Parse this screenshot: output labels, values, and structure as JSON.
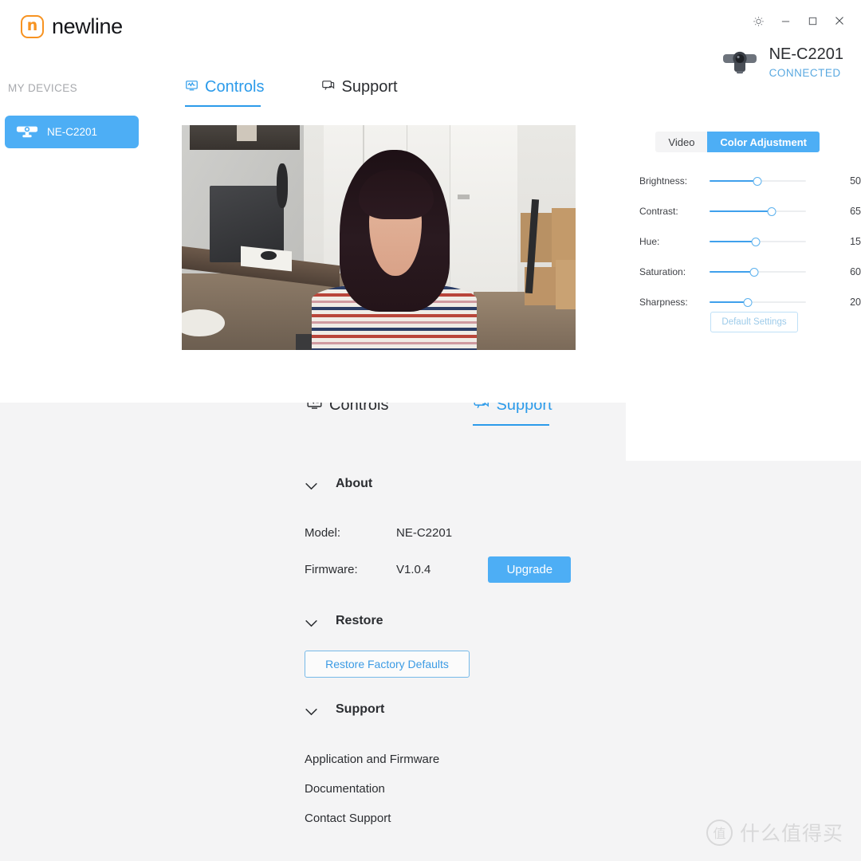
{
  "app": {
    "brand_name": "newline",
    "brand_mark_letter": "n",
    "brand_color": "#F79321",
    "accent_color": "#4DAEF5",
    "window_buttons": [
      {
        "name": "brightness-icon",
        "label": "Brightness"
      },
      {
        "name": "minimize",
        "label": "Minimize"
      },
      {
        "name": "maximize",
        "label": "Maximize"
      },
      {
        "name": "close",
        "label": "Close"
      }
    ]
  },
  "sidebar": {
    "heading": "MY DEVICES",
    "items": [
      {
        "label": "NE-C2201",
        "icon": "webcam-icon",
        "selected": true
      }
    ]
  },
  "device_status": {
    "icon": "webcam-icon",
    "name": "NE-C2201",
    "status": "CONNECTED",
    "status_color": "#5aa9e0"
  },
  "controls_view": {
    "tabs": [
      {
        "label": "Controls",
        "icon": "monitor-icon",
        "active": true
      },
      {
        "label": "Support",
        "icon": "chat-icon",
        "active": false
      }
    ],
    "preview": {
      "alt": "live camera preview"
    },
    "segmented": {
      "options": [
        "Video",
        "Color Adjustment"
      ],
      "selected": "Color Adjustment"
    },
    "sliders": [
      {
        "label": "Brightness:",
        "value": 50,
        "percent": 50
      },
      {
        "label": "Contrast:",
        "value": 65,
        "percent": 65
      },
      {
        "label": "Hue:",
        "value": 15,
        "percent": 48
      },
      {
        "label": "Saturation:",
        "value": 60,
        "percent": 46
      },
      {
        "label": "Sharpness:",
        "value": 20,
        "percent": 40
      }
    ],
    "default_button": "Default Settings"
  },
  "support_view": {
    "tabs": [
      {
        "label": "Controls",
        "icon": "monitor-icon",
        "active": false
      },
      {
        "label": "Support",
        "icon": "chat-icon",
        "active": true
      }
    ],
    "sections": {
      "about": {
        "title": "About",
        "model_label": "Model:",
        "model_value": "NE-C2201",
        "firmware_label": "Firmware:",
        "firmware_value": "V1.0.4",
        "upgrade_button": "Upgrade"
      },
      "restore": {
        "title": "Restore",
        "button": "Restore Factory Defaults"
      },
      "support": {
        "title": "Support",
        "links": [
          "Application and Firmware",
          "Documentation",
          "Contact Support"
        ]
      }
    }
  },
  "watermark": {
    "badge": "值",
    "text": "什么值得买"
  }
}
